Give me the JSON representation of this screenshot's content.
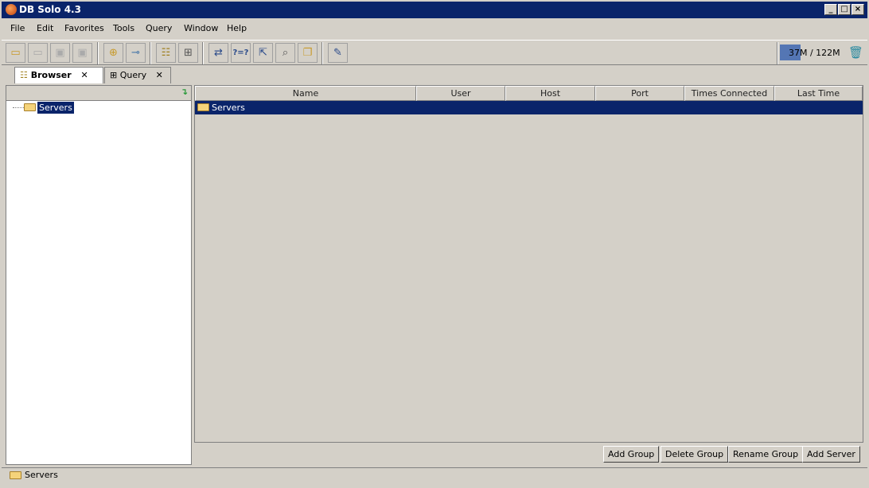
{
  "window": {
    "title": "DB Solo  4.3"
  },
  "menu": [
    "File",
    "Edit",
    "Favorites",
    "Tools",
    "Query",
    "Window",
    "Help"
  ],
  "toolbar": [
    "open-icon",
    "open-disabled-icon",
    "save-icon",
    "save-as-icon",
    "add-connection-icon",
    "connect-icon",
    "tree-browser-icon",
    "query-grid-icon",
    "compare-icon",
    "question-icon",
    "export-icon",
    "search-icon",
    "copy-icon",
    "edit-tree-icon"
  ],
  "memory": {
    "label": "37M / 122M",
    "used_fraction": 0.3
  },
  "tabs": [
    {
      "label": "Browser",
      "active": true
    },
    {
      "label": "Query",
      "active": false
    }
  ],
  "tree": {
    "root": "Servers"
  },
  "table": {
    "columns": [
      "Name",
      "User",
      "Host",
      "Port",
      "Times Connected",
      "Last Time Connected"
    ],
    "rows": [
      {
        "name": "Servers"
      }
    ]
  },
  "buttons": {
    "add_group": "Add Group",
    "delete_group": "Delete Group",
    "rename_group": "Rename Group",
    "add_server": "Add Server"
  },
  "status": {
    "text": "Servers"
  }
}
